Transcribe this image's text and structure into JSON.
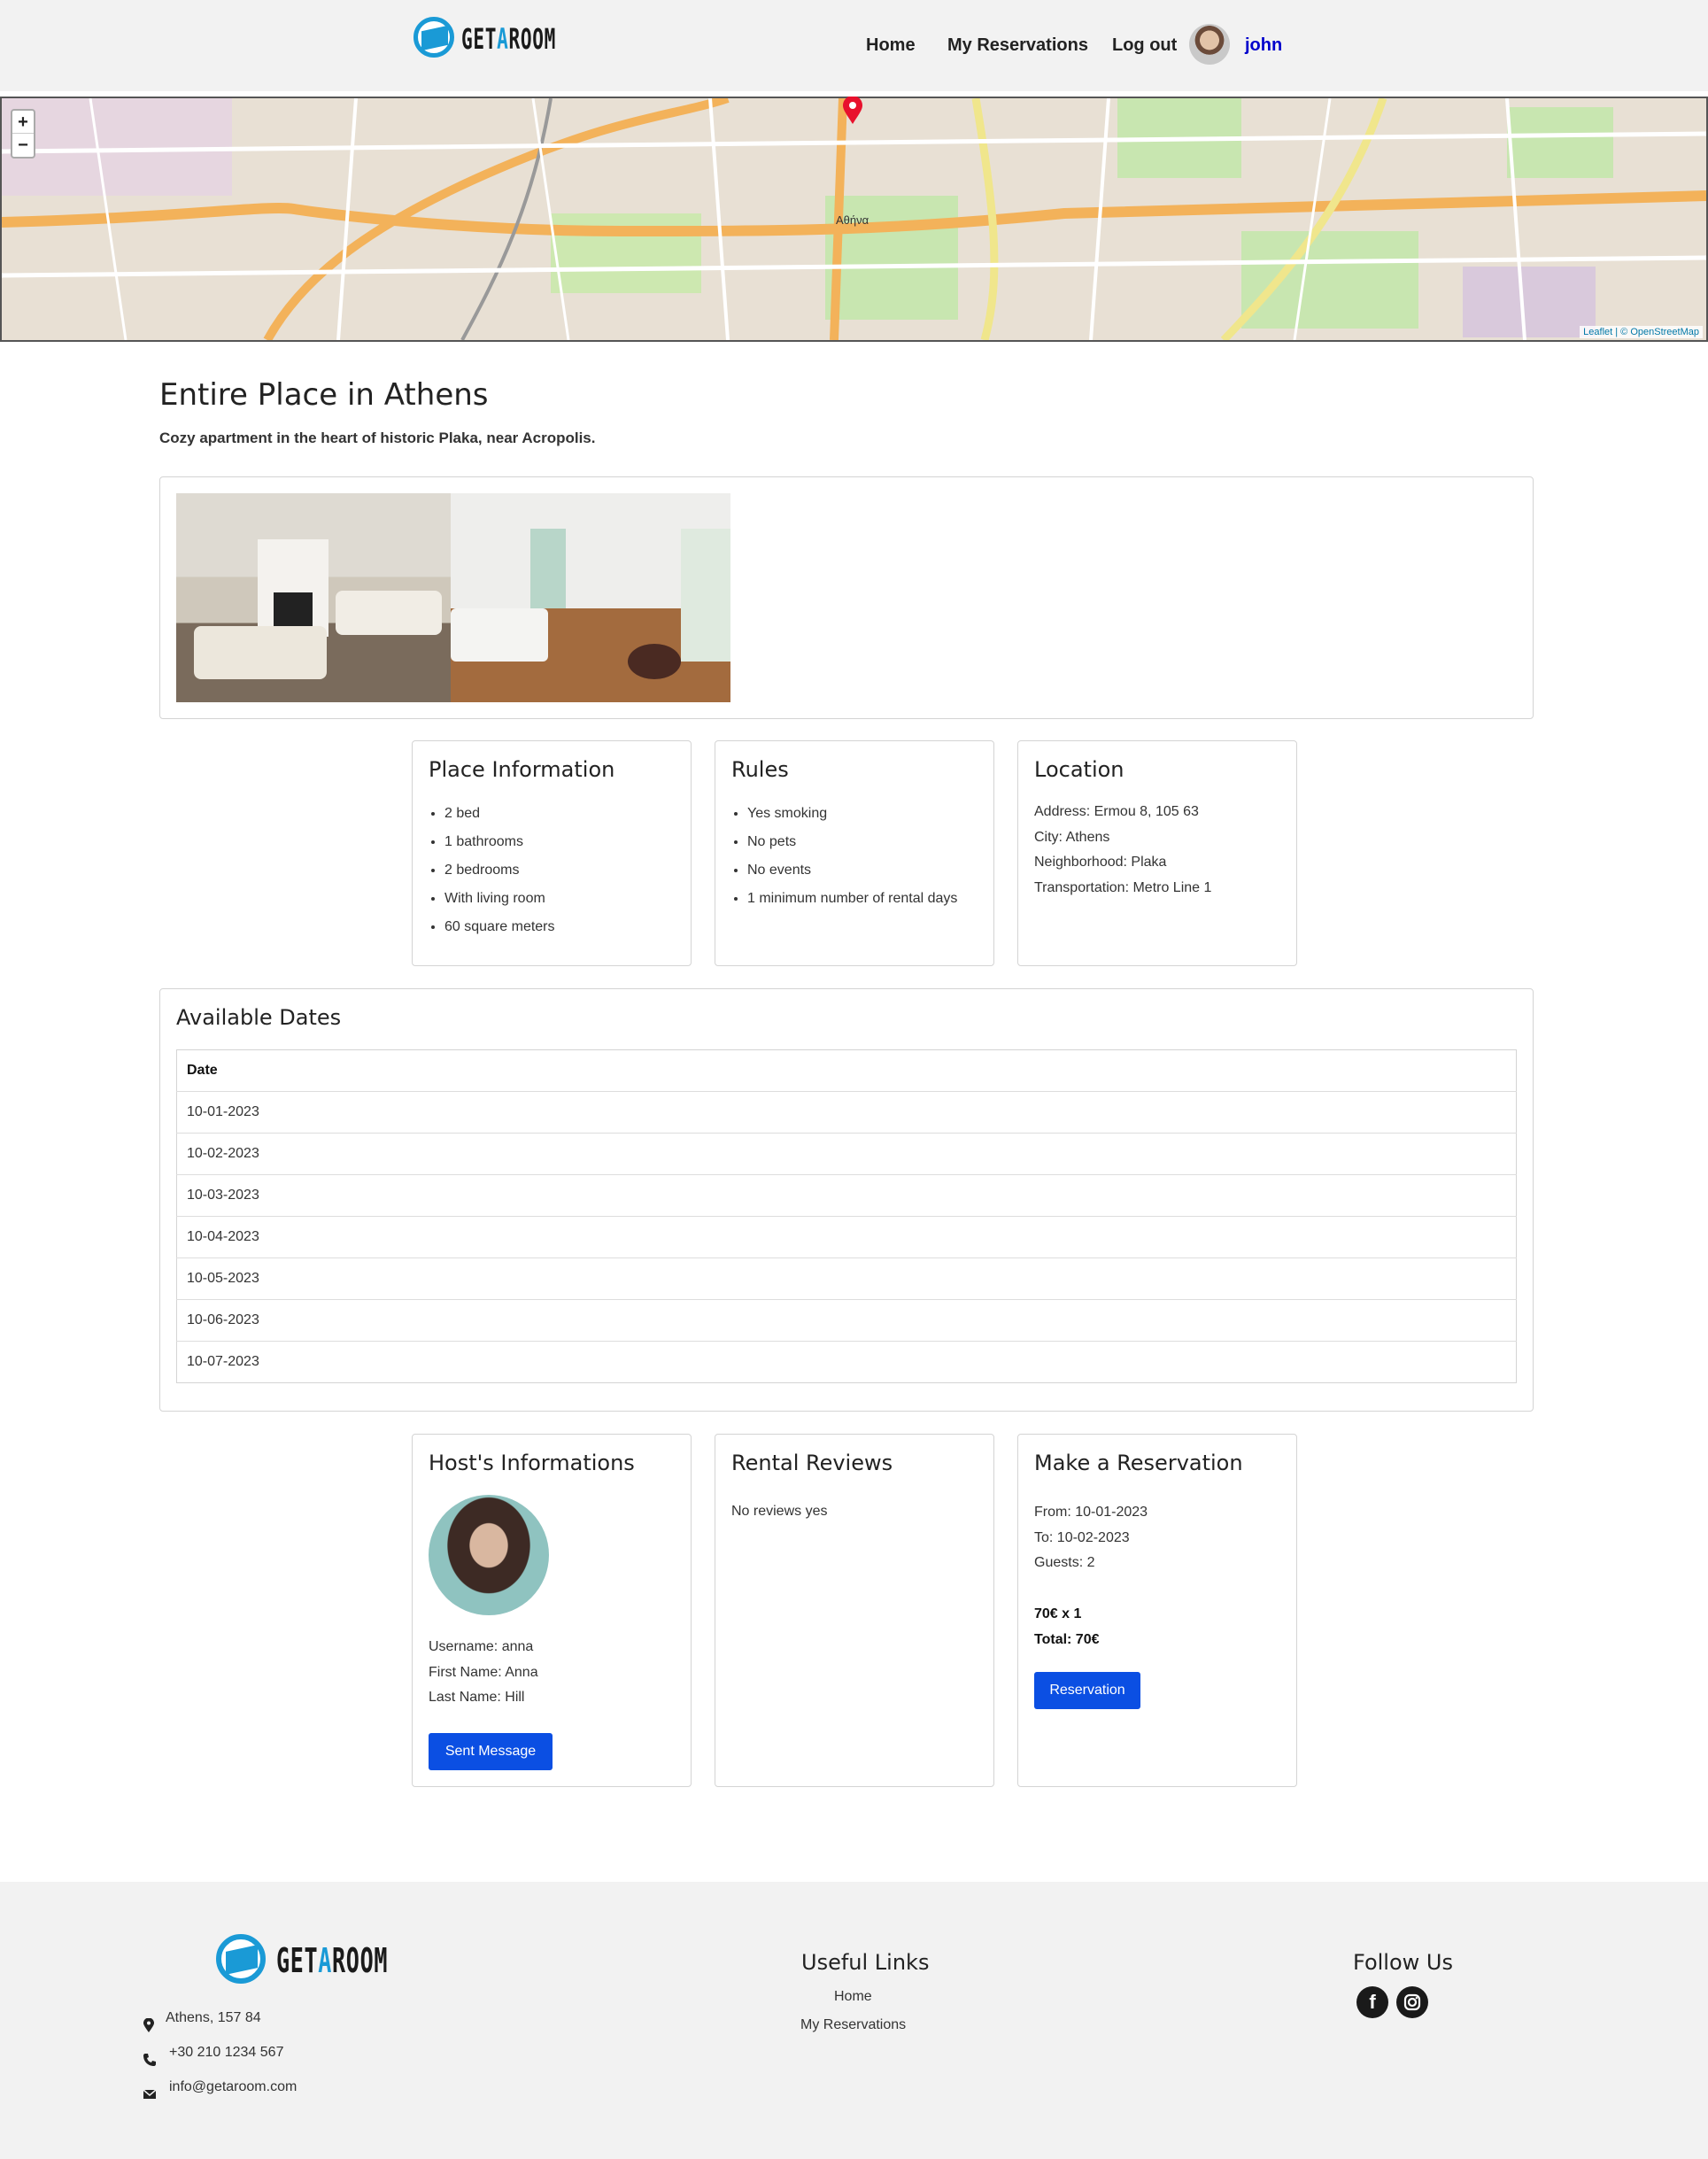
{
  "header": {
    "logo": {
      "prefix": "GET",
      "accent": "A",
      "suffix": "ROOM"
    },
    "nav": [
      "Home",
      "My Reservations",
      "Log out"
    ],
    "username": "john"
  },
  "map": {
    "zoom_in": "+",
    "zoom_out": "−",
    "attribution": "Leaflet | © OpenStreetMap",
    "marker_label": "Αθήνα"
  },
  "listing": {
    "title": "Entire Place in Athens",
    "subtitle": "Cozy apartment in the heart of historic Plaka, near Acropolis."
  },
  "place_info": {
    "heading": "Place Information",
    "items": [
      "2 bed",
      "1 bathrooms",
      "2 bedrooms",
      "With living room",
      "60 square meters"
    ]
  },
  "rules": {
    "heading": "Rules",
    "items": [
      "Yes smoking",
      "No pets",
      "No events",
      "1 minimum number of rental days"
    ]
  },
  "location": {
    "heading": "Location",
    "lines": [
      "Address: Ermou 8, 105 63",
      "City: Athens",
      "Neighborhood: Plaka",
      "Transportation: Metro Line 1"
    ]
  },
  "dates": {
    "heading": "Available Dates",
    "column": "Date",
    "rows": [
      "10-01-2023",
      "10-02-2023",
      "10-03-2023",
      "10-04-2023",
      "10-05-2023",
      "10-06-2023",
      "10-07-2023"
    ]
  },
  "host": {
    "heading": "Host's Informations",
    "lines": [
      "Username: anna",
      "First Name: Anna",
      "Last Name: Hill"
    ],
    "button": "Sent Message"
  },
  "reviews": {
    "heading": "Rental Reviews",
    "text": "No reviews yes"
  },
  "reservation": {
    "heading": "Make a Reservation",
    "lines": [
      "From: 10-01-2023",
      "To: 10-02-2023",
      "Guests: 2"
    ],
    "price_line": "70€ x 1",
    "total": "Total: 70€",
    "button": "Reservation"
  },
  "footer": {
    "address": "Athens, 157 84",
    "phone": "+30 210 1234 567",
    "email": "info@getaroom.com",
    "useful_heading": "Useful Links",
    "links": [
      "Home",
      "My Reservations"
    ],
    "follow_heading": "Follow Us",
    "social": [
      "facebook",
      "instagram"
    ]
  },
  "colors": {
    "accent": "#1a9ad6",
    "button": "#0b4fe3",
    "username": "#0000cc",
    "header_bg": "#f2f2f2"
  }
}
